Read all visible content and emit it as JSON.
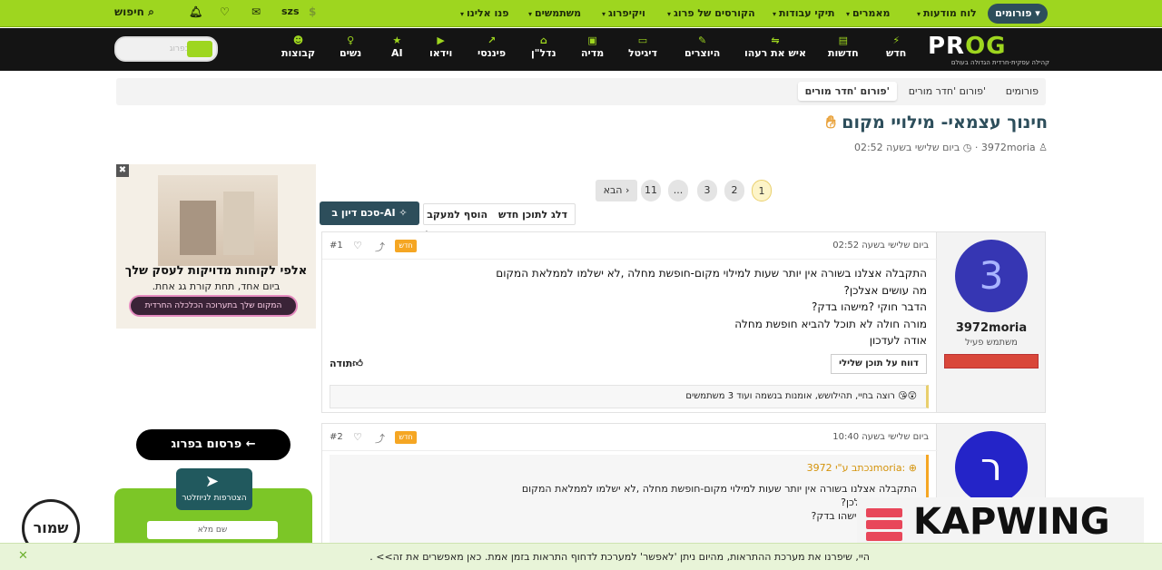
{
  "topbar": {
    "forums_label": "פורומים",
    "items": [
      "לוח מודעות",
      "מאמרים",
      "תיקי עבודות",
      "הקורסים של פרוג",
      "ויקיפרוג",
      "משתמשים",
      "פנו אלינו"
    ],
    "user": "szs",
    "search_label": "חיפוש"
  },
  "logo": {
    "text_a": "PR",
    "text_b": "OG",
    "tagline": "קהילה עסקית-חרדית הגדולה בעולם"
  },
  "nav": [
    "חדש",
    "חדשות",
    "היוצרים",
    "איש את רעהו",
    "דיגיטל",
    "מדיה",
    "נדל\"ן",
    "פיננסי",
    "וידאו",
    "AI",
    "נשים",
    "קבוצות"
  ],
  "search": {
    "placeholder": "חפשו בפרוג"
  },
  "breadcrumbs": [
    "פורומים",
    "פורום 'חדר מורים'",
    "פורום 'חדר מורים'"
  ],
  "thread": {
    "title": "חינוך עצמאי- מילויי מקום",
    "author": "3972moria",
    "time": "ביום שלישי בשעה 02:52"
  },
  "ad": {
    "headline": "אלפי לקוחות מדויקות לעסק שלך",
    "sub": "ביום אחד, תחת קורת גג אחת.",
    "cta": "המקום שלך בתערוכה הכלכלה החרדית",
    "close": "✖"
  },
  "pagination": {
    "pages": [
      "1",
      "2",
      "3",
      "...",
      "11"
    ],
    "next": "הבא ›",
    "current": "1"
  },
  "actions": {
    "jump_new": "דלג לתוכן חדש",
    "follow": "הוסף למעקב",
    "ai_summary": "סכם דיון ב-AI"
  },
  "posts": [
    {
      "avatar_letter": "3",
      "username": "3972moria",
      "role": "משתמש פעיל",
      "date": "ביום שלישי בשעה 02:52",
      "number": "#1",
      "badge": "חדש",
      "lines": [
        "התקבלה אצלנו בשורה אין יותר שעות למילוי מקום-חופשת מחלה ,לא ישלמו לממלאת המקום",
        "מה עושים אצלכן?",
        "הדבר חוקי ?מישהו בדק?",
        "מורה חולה לא תוכל להביא חופשת מחלה",
        "אודה לעדכון"
      ],
      "report": "דווח על תוכן שלילי",
      "thanks": "תודה",
      "reactions": "רוצה בחיי, תהילושש, אומנות בנשמה ועוד 3 משתמשים"
    },
    {
      "avatar_letter": "ר",
      "date": "ביום שלישי בשעה 10:40",
      "number": "#2",
      "badge": "חדש",
      "quote_header": "נכתב ע\"י 3972moria:",
      "quote_lines": [
        "התקבלה אצלנו בשורה אין יותר שעות למילוי מקום-חופשת מחלה ,לא ישלמו לממלאת המקום",
        "מה עושים אצלכן?",
        "הדבר חוקי ?מישהו בדק?"
      ]
    }
  ],
  "sidebar": {
    "publish": "פרסום בפרוג ←",
    "telegram": "הצטרפות לניוזלטר",
    "name_field": "שם מלא",
    "stamp": "שמור"
  },
  "notice": "היי, שיפרנו את מערכת ההתראות, מהיום ניתן 'לאפשר' למערכת לדחוף התראות בזמן אמת. כאן מאפשרים את זה>> .",
  "notice_close": "✕",
  "watermark": "KAPWING"
}
